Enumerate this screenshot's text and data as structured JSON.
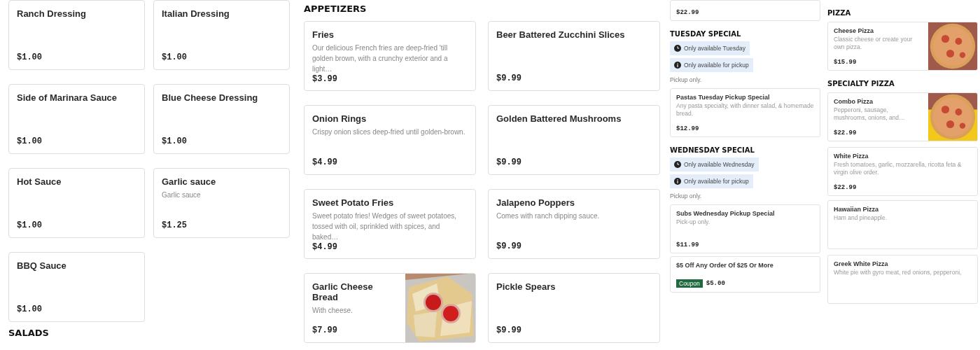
{
  "sauces": {
    "items": [
      {
        "name": "Ranch Dressing",
        "price": "$1.00"
      },
      {
        "name": "Italian Dressing",
        "price": "$1.00"
      },
      {
        "name": "Side of Marinara Sauce",
        "price": "$1.00"
      },
      {
        "name": "Blue Cheese Dressing",
        "price": "$1.00"
      },
      {
        "name": "Hot Sauce",
        "price": "$1.00"
      },
      {
        "name": "Garlic sauce",
        "description": "Garlic sauce",
        "price": "$1.25"
      },
      {
        "name": "BBQ Sauce",
        "price": "$1.00"
      }
    ],
    "next_heading": "SALADS"
  },
  "appetizers": {
    "heading": "APPETIZERS",
    "items": [
      {
        "name": "Fries",
        "description": "Our delicious French fries are deep-fried 'till golden brown, with a crunchy exterior and a light…",
        "price": "$3.99"
      },
      {
        "name": "Beer Battered Zucchini Slices",
        "price": "$9.99"
      },
      {
        "name": "Onion Rings",
        "description": "Crispy onion slices deep-fried until golden-brown.",
        "price": "$4.99"
      },
      {
        "name": "Golden Battered Mushrooms",
        "price": "$9.99"
      },
      {
        "name": "Sweet Potato Fries",
        "description": "Sweet potato fries! Wedges of sweet potatoes, tossed with oil, sprinkled with spices, and baked…",
        "price": "$4.99"
      },
      {
        "name": "Jalapeno Poppers",
        "description": "Comes with ranch dipping sauce.",
        "price": "$9.99"
      },
      {
        "name": "Garlic Cheese Bread",
        "description": "With cheese.",
        "price": "$7.99"
      },
      {
        "name": "Pickle Spears",
        "price": "$9.99"
      }
    ]
  },
  "specials": [
    {
      "kind": "cards",
      "cards": [
        {
          "price": "$22.99"
        }
      ]
    },
    {
      "kind": "heading",
      "text": "TUESDAY SPECIAL"
    },
    {
      "kind": "badges",
      "badges": [
        "Only available Tuesday",
        "Only available for pickup"
      ]
    },
    {
      "kind": "note",
      "text": "Pickup only."
    },
    {
      "kind": "cards",
      "cards": [
        {
          "name": "Pastas Tuesday Pickup Special",
          "description": "Any pasta specialty, with dinner salad, & homemade bread.",
          "price": "$12.99"
        }
      ]
    },
    {
      "kind": "heading",
      "text": "WEDNESDAY SPECIAL"
    },
    {
      "kind": "badges",
      "badges": [
        "Only available Wednesday",
        "Only available for pickup"
      ]
    },
    {
      "kind": "note",
      "text": "Pickup only."
    },
    {
      "kind": "cards",
      "cards": [
        {
          "name": "Subs Wednesday Pickup Special",
          "description": "Pick-up only.",
          "price": "$11.99"
        }
      ]
    },
    {
      "kind": "cards",
      "cards": [
        {
          "name": "$5 Off Any Order Of $25 Or More",
          "tag": "Coupon",
          "price": "$5.00"
        }
      ]
    },
    {
      "kind": "heading",
      "text": "PIZZA"
    },
    {
      "kind": "cards",
      "cards": [
        {
          "name": "Cheese Pizza",
          "description": "Classic cheese or create your own pizza.",
          "price": "$15.99"
        }
      ]
    },
    {
      "kind": "heading",
      "text": "SPECIALTY PIZZA"
    },
    {
      "kind": "cards",
      "cards": [
        {
          "name": "Combo Pizza",
          "description": "Pepperoni, sausage, mushrooms, onions, and…",
          "price": "$22.99"
        },
        {
          "name": "White Pizza",
          "description": "Fresh tomatoes, garlic, mozzarella, ricotta feta & virgin olive order.",
          "price": "$22.99"
        }
      ]
    },
    {
      "kind": "cards",
      "cards": [
        {
          "name": "Hawaiian Pizza",
          "description": "Ham and pineapple."
        },
        {
          "name": "Greek White Pizza",
          "description": "White pie with gyro meat, red onions, pepperoni,"
        }
      ]
    }
  ]
}
